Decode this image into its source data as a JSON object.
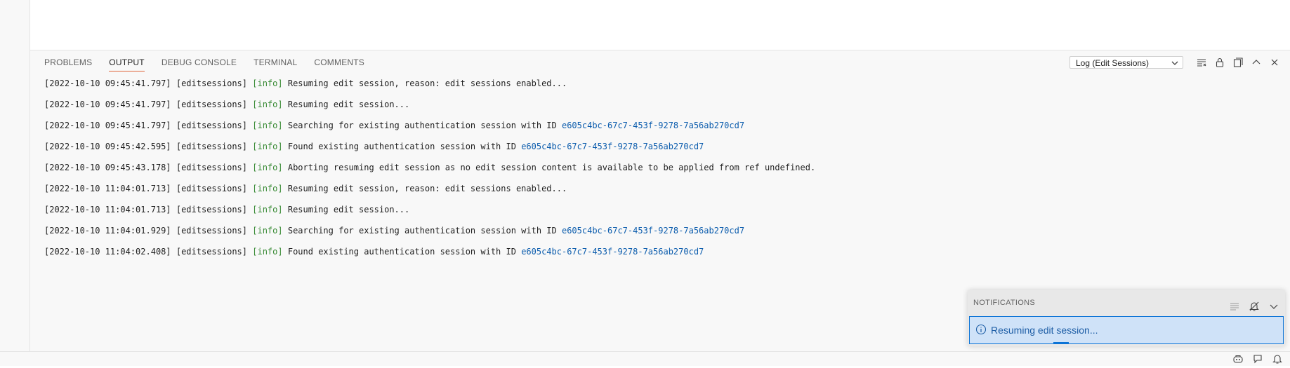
{
  "panel": {
    "tabs": [
      {
        "label": "PROBLEMS"
      },
      {
        "label": "OUTPUT"
      },
      {
        "label": "DEBUG CONSOLE"
      },
      {
        "label": "TERMINAL"
      },
      {
        "label": "COMMENTS"
      }
    ],
    "active_tab": "OUTPUT",
    "channel_select": "Log (Edit Sessions)"
  },
  "log": [
    {
      "ts": "[2022-10-10 09:45:41.797]",
      "src": "[editsessions]",
      "lvl": "[info]",
      "msg": "Resuming edit session, reason: edit sessions enabled...",
      "id": ""
    },
    {
      "ts": "[2022-10-10 09:45:41.797]",
      "src": "[editsessions]",
      "lvl": "[info]",
      "msg": "Resuming edit session...",
      "id": ""
    },
    {
      "ts": "[2022-10-10 09:45:41.797]",
      "src": "[editsessions]",
      "lvl": "[info]",
      "msg": "Searching for existing authentication session with ID",
      "id": "e605c4bc-67c7-453f-9278-7a56ab270cd7"
    },
    {
      "ts": "[2022-10-10 09:45:42.595]",
      "src": "[editsessions]",
      "lvl": "[info]",
      "msg": "Found existing authentication session with ID",
      "id": "e605c4bc-67c7-453f-9278-7a56ab270cd7"
    },
    {
      "ts": "[2022-10-10 09:45:43.178]",
      "src": "[editsessions]",
      "lvl": "[info]",
      "msg": "Aborting resuming edit session as no edit session content is available to be applied from ref undefined.",
      "id": ""
    },
    {
      "ts": "[2022-10-10 11:04:01.713]",
      "src": "[editsessions]",
      "lvl": "[info]",
      "msg": "Resuming edit session, reason: edit sessions enabled...",
      "id": ""
    },
    {
      "ts": "[2022-10-10 11:04:01.713]",
      "src": "[editsessions]",
      "lvl": "[info]",
      "msg": "Resuming edit session...",
      "id": ""
    },
    {
      "ts": "[2022-10-10 11:04:01.929]",
      "src": "[editsessions]",
      "lvl": "[info]",
      "msg": "Searching for existing authentication session with ID",
      "id": "e605c4bc-67c7-453f-9278-7a56ab270cd7"
    },
    {
      "ts": "[2022-10-10 11:04:02.408]",
      "src": "[editsessions]",
      "lvl": "[info]",
      "msg": "Found existing authentication session with ID",
      "id": "e605c4bc-67c7-453f-9278-7a56ab270cd7"
    }
  ],
  "notifications": {
    "header": "NOTIFICATIONS",
    "items": [
      {
        "text": "Resuming edit session..."
      }
    ]
  },
  "icons": {
    "clear_output": "clear-output-icon",
    "lock": "lock-icon",
    "open_editor": "open-in-editor-icon",
    "maximize": "chevron-up-icon",
    "close": "close-icon",
    "do_not_disturb": "bell-slash-icon",
    "collapse": "chevron-down-icon",
    "info": "info-icon",
    "copilot": "copilot-icon",
    "feedback": "feedback-icon",
    "bell": "bell-icon"
  },
  "colors": {
    "accent": "#e0643a",
    "info_level": "#388a34",
    "session_id": "#0b5cad",
    "notification_bg": "#cfe2f8"
  }
}
